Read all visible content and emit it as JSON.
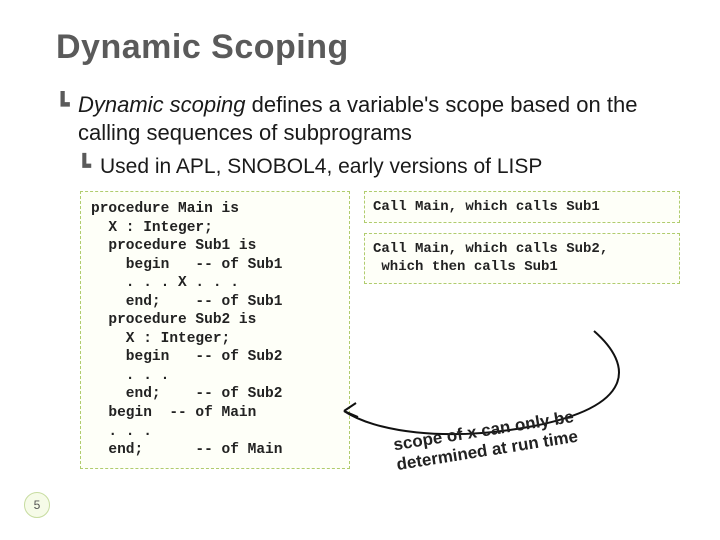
{
  "title": "Dynamic Scoping",
  "bullet_main_prefix": "Dynamic scoping",
  "bullet_main_rest": " defines a variable's scope based on the calling sequences of subprograms",
  "bullet_sub": "Used in APL, SNOBOL4, early versions of LISP",
  "code": "procedure Main is\n  X : Integer;\n  procedure Sub1 is\n    begin   -- of Sub1\n    . . . X . . .\n    end;    -- of Sub1\n  procedure Sub2 is\n    X : Integer;\n    begin   -- of Sub2\n    . . .\n    end;    -- of Sub2\n  begin  -- of Main\n  . . .\n  end;      -- of Main",
  "call1": "Call Main, which calls Sub1",
  "call2": "Call Main, which calls Sub2,\n which then calls Sub1",
  "note_line1": "scope of x can only be",
  "note_line2": "determined at run time",
  "page_number": "5"
}
